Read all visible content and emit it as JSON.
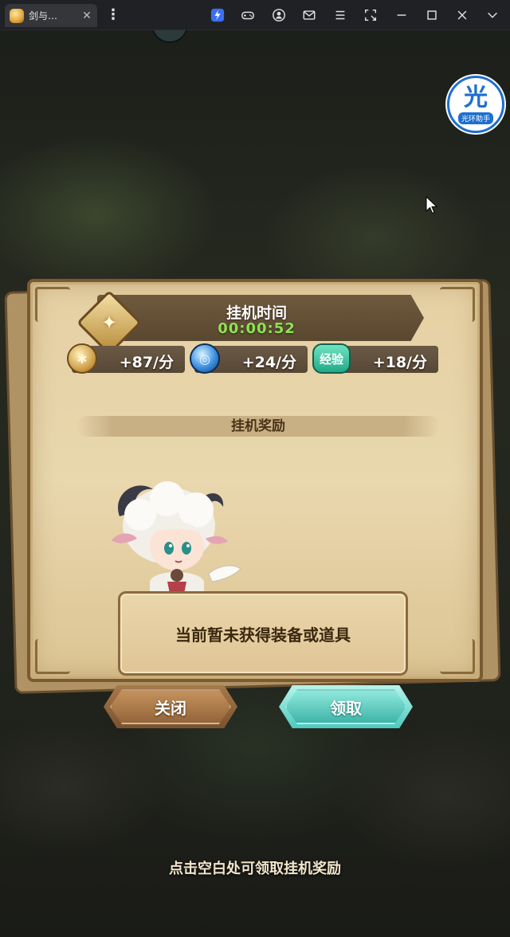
{
  "window": {
    "tab_title": "剑与…",
    "tab_close": "✕",
    "menu": "⋮",
    "icons": [
      "bolt-icon",
      "gamepad-icon",
      "user-icon",
      "mail-icon",
      "menu-icon",
      "screenshot-icon",
      "minimize-icon",
      "maximize-icon",
      "close-icon"
    ]
  },
  "overlay": {
    "helper_glyph": "光",
    "helper_label": "光环助手"
  },
  "dialog": {
    "title": "挂机时间",
    "timer": "00:00:52",
    "rates": [
      {
        "icon": "gold-coin-icon",
        "value": "+87/分"
      },
      {
        "icon": "hero-dust-icon",
        "value": "+24/分"
      },
      {
        "label": "经验",
        "value": "+18/分"
      }
    ],
    "section_title": "挂机奖励",
    "empty_message": "当前暂未获得装备或道具",
    "close_label": "关闭",
    "claim_label": "领取"
  },
  "footer_hint": "点击空白处可领取挂机奖励",
  "colors": {
    "timer": "#8fe255",
    "claim_button": "#4ec9bf",
    "close_button": "#7a5230",
    "parchment": "#e5d0a3"
  }
}
